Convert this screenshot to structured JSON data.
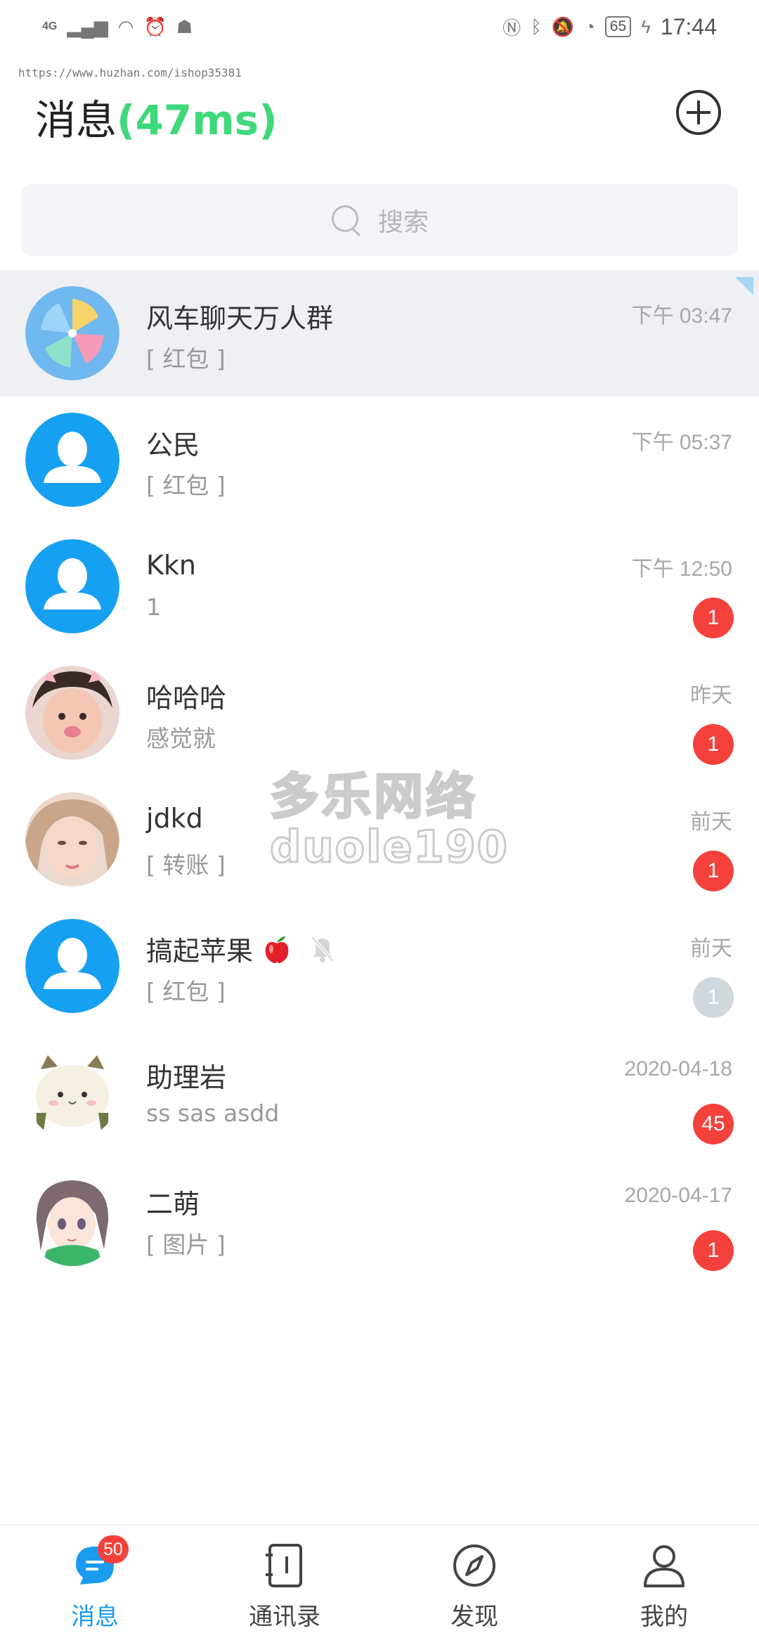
{
  "status_bar": {
    "network": "4G",
    "battery": "65",
    "time": "17:44"
  },
  "watermark_url": "https://www.huzhan.com/ishop35381",
  "header": {
    "title": "消息",
    "latency": "(47ms)"
  },
  "search": {
    "placeholder": "搜索"
  },
  "conversations": [
    {
      "name": "风车聊天万人群",
      "preview": "[ 红包 ]",
      "time": "下午 03:47",
      "badge": "",
      "pinned": true,
      "avatar": "pinwheel"
    },
    {
      "name": "公民",
      "preview": "[ 红包 ]",
      "time": "下午 05:37",
      "badge": "",
      "avatar": "default-user"
    },
    {
      "name": "Kkn",
      "preview": "1",
      "time": "下午 12:50",
      "badge": "1",
      "avatar": "default-user"
    },
    {
      "name": "哈哈哈",
      "preview": "感觉就",
      "time": "昨天",
      "badge": "1",
      "avatar": "photo-girl"
    },
    {
      "name": "jdkd",
      "preview": "[ 转账 ]",
      "time": "前天",
      "badge": "1",
      "avatar": "photo-woman"
    },
    {
      "name": "搞起苹果",
      "preview": "[ 红包 ]",
      "time": "前天",
      "badge": "1",
      "muted": true,
      "avatar": "default-user"
    },
    {
      "name": "助理岩",
      "preview": "ss  sas  asdd",
      "time": "2020-04-18",
      "badge": "45",
      "avatar": "cat-cartoon"
    },
    {
      "name": "二萌",
      "preview": "[ 图片 ]",
      "time": "2020-04-17",
      "badge": "1",
      "avatar": "anime-girl"
    }
  ],
  "overlay_watermark": {
    "line1": "多乐网络",
    "line2": "duole190"
  },
  "tabs": [
    {
      "label": "消息",
      "badge": "50",
      "active": true,
      "icon": "chat-icon"
    },
    {
      "label": "通讯录",
      "icon": "contacts-book-icon"
    },
    {
      "label": "发现",
      "icon": "compass-icon"
    },
    {
      "label": "我的",
      "icon": "person-icon"
    }
  ],
  "colors": {
    "accent_blue": "#1a9bf0",
    "latency_green": "#3fd87a",
    "badge_red": "#f5413c",
    "muted_badge": "#cfd8dc",
    "pinned_bg": "#eef0f3"
  }
}
